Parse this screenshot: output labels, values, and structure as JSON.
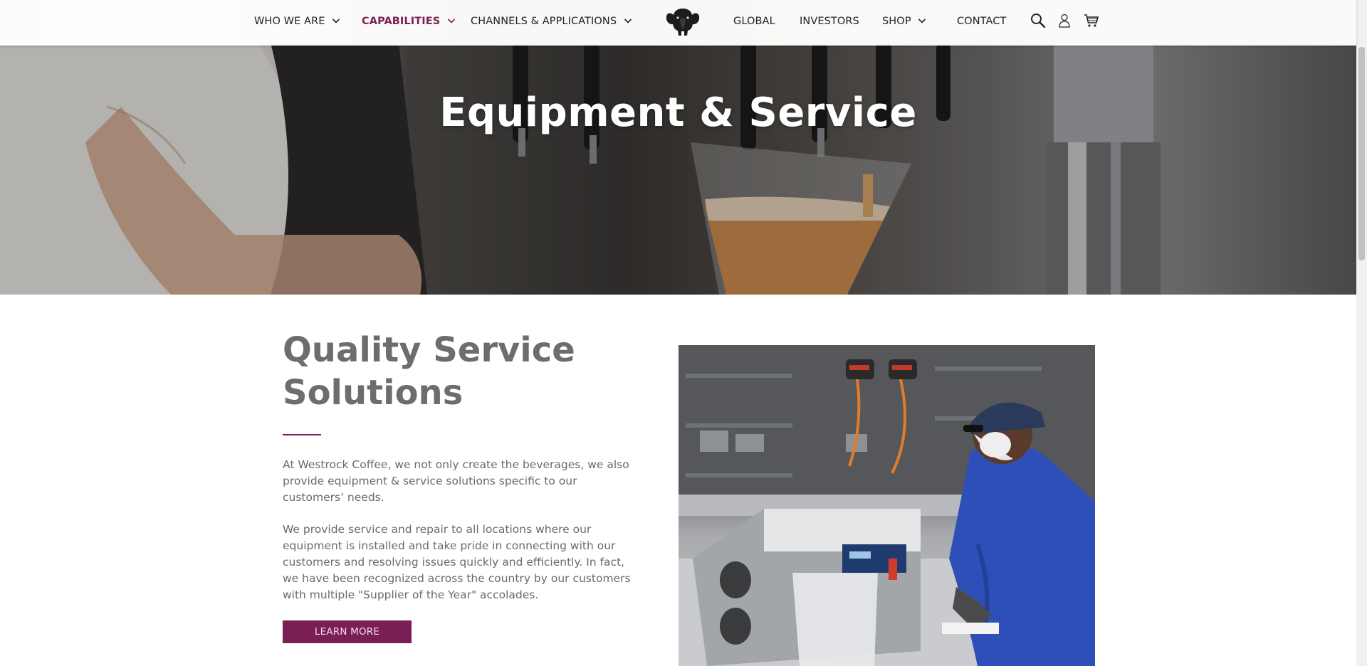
{
  "nav": {
    "left_items": [
      {
        "label": "WHO WE ARE",
        "has_dropdown": true
      },
      {
        "label": "CAPABILITIES",
        "has_dropdown": true,
        "active": true
      },
      {
        "label": "CHANNELS & APPLICATIONS",
        "has_dropdown": true
      }
    ],
    "right_items": [
      {
        "label": "GLOBAL"
      },
      {
        "label": "INVESTORS"
      },
      {
        "label": "SHOP",
        "has_dropdown": true
      },
      {
        "label": "CONTACT"
      }
    ],
    "icons": [
      "search-icon",
      "account-icon",
      "cart-icon"
    ],
    "logo": "elephant-logo"
  },
  "hero": {
    "title": "Equipment & Service"
  },
  "section": {
    "title_line1": "Quality Service",
    "title_line2": "Solutions",
    "paragraph1": "At Westrock Coffee, we not only create the beverages, we also provide equipment & service solutions specific to our customers’ needs.",
    "paragraph2": "We provide service and repair to all locations where our equipment is installed and take pride in connecting with our customers and resolving issues quickly and efficiently. In fact, we have been recognized across the country by our customers with multiple \"Supplier of the Year\" accolades.",
    "button_label": "LEARN MORE"
  },
  "colors": {
    "accent": "#7a1f55",
    "heading_gray": "#6d6d6d",
    "body_gray": "#6a6a6a"
  }
}
